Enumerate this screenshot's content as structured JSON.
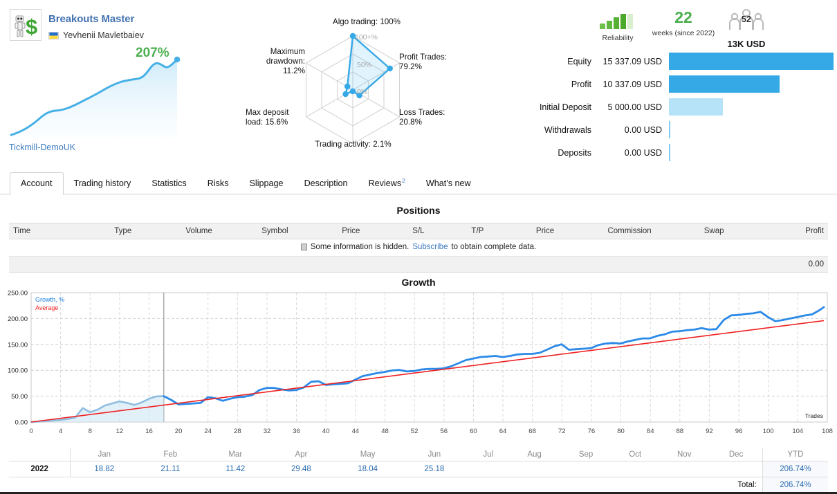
{
  "signal": {
    "title": "Breakouts Master",
    "author": "Yevhenii Mavletbaiev",
    "growth_percent": "207%",
    "broker": "Tickmill-DemoUK",
    "logo_icon": "robot-dollar-icon",
    "flag_icon": "ukraine-flag-icon"
  },
  "radar": {
    "axes": [
      {
        "name": "algo-trading",
        "label": "Algo trading: 100%",
        "value": 100
      },
      {
        "name": "profit-trades",
        "label": "Profit Trades:\n79.2%",
        "value": 79.2
      },
      {
        "name": "loss-trades",
        "label": "Loss Trades:\n20.8%",
        "value": 20.8
      },
      {
        "name": "trading-activity",
        "label": "Trading activity: 2.1%",
        "value": 2.1
      },
      {
        "name": "max-deposit-load",
        "label": "Max deposit\nload: 15.6%",
        "value": 15.6
      },
      {
        "name": "maximum-drawdown",
        "label": "Maximum\ndrawdown:\n11.2%",
        "value": 11.2
      }
    ],
    "ring_labels": [
      "100+%",
      "50%",
      "0%"
    ],
    "label_algo": "Algo trading: 100%",
    "label_profit_1": "Profit Trades:",
    "label_profit_2": "79.2%",
    "label_loss_1": "Loss Trades:",
    "label_loss_2": "20.8%",
    "label_activity": "Trading activity: 2.1%",
    "label_maxload_1": "Max deposit",
    "label_maxload_2": "load: 15.6%",
    "label_drawdown_1": "Maximum",
    "label_drawdown_2": "drawdown:",
    "label_drawdown_3": "11.2%"
  },
  "badges": {
    "reliability_caption": "Reliability",
    "reliability_filled": 4,
    "reliability_total": 5,
    "weeks_value": "22",
    "weeks_caption": "weeks (since 2022)",
    "subscribers_count": "52",
    "subscribers_caption": "13K USD"
  },
  "stats": [
    {
      "name": "Equity",
      "value": "15 337.09 USD",
      "bar_percent": 100,
      "bar_style": "solid"
    },
    {
      "name": "Profit",
      "value": "10 337.09 USD",
      "bar_percent": 67.4,
      "bar_style": "solid"
    },
    {
      "name": "Initial Deposit",
      "value": "5 000.00 USD",
      "bar_percent": 32.6,
      "bar_style": "light"
    },
    {
      "name": "Withdrawals",
      "value": "0.00 USD",
      "bar_percent": 0,
      "bar_style": "tiny"
    },
    {
      "name": "Deposits",
      "value": "0.00 USD",
      "bar_percent": 0,
      "bar_style": "tiny"
    }
  ],
  "tabs": [
    {
      "label": "Account",
      "active": true,
      "sup": ""
    },
    {
      "label": "Trading history",
      "active": false,
      "sup": ""
    },
    {
      "label": "Statistics",
      "active": false,
      "sup": ""
    },
    {
      "label": "Risks",
      "active": false,
      "sup": ""
    },
    {
      "label": "Slippage",
      "active": false,
      "sup": ""
    },
    {
      "label": "Description",
      "active": false,
      "sup": ""
    },
    {
      "label": "Reviews",
      "active": false,
      "sup": "2"
    },
    {
      "label": "What's new",
      "active": false,
      "sup": ""
    }
  ],
  "positions": {
    "title": "Positions",
    "columns": [
      "Time",
      "Type",
      "Volume",
      "Symbol",
      "Price",
      "S/L",
      "T/P",
      "Price",
      "Commission",
      "Swap",
      "Profit"
    ],
    "hidden_text_1": "Some information is hidden.",
    "hidden_link": "Subscribe",
    "hidden_text_2": "to obtain complete data.",
    "total_profit": "0.00"
  },
  "growth": {
    "title": "Growth"
  },
  "chart_data": {
    "type": "line",
    "title": "Growth",
    "xlabel": "Trades",
    "ylabel": "",
    "xlim": [
      0,
      108
    ],
    "ylim": [
      0,
      250
    ],
    "xticks": [
      0,
      4,
      8,
      12,
      16,
      20,
      24,
      28,
      32,
      36,
      40,
      44,
      48,
      52,
      56,
      60,
      64,
      68,
      72,
      76,
      80,
      84,
      88,
      92,
      96,
      100,
      104,
      108
    ],
    "yticks": [
      "0.00",
      "50.00",
      "100.00",
      "150.00",
      "200.00",
      "250.00"
    ],
    "grid": true,
    "legend": [
      "Growth, %",
      "Average"
    ],
    "legend_position": "top-left",
    "legend_colors": [
      "#1e7fe0",
      "#f02020"
    ],
    "demo_split_x": 18,
    "series": [
      {
        "name": "Growth, %",
        "color": "#2b8ae8",
        "x": [
          0,
          1,
          2,
          3,
          4,
          5,
          6,
          7,
          8,
          9,
          10,
          11,
          12,
          13,
          14,
          15,
          16,
          17,
          18,
          19,
          20,
          21,
          22,
          23,
          24,
          25,
          26,
          27,
          28,
          29,
          30,
          31,
          32,
          33,
          34,
          35,
          36,
          37,
          38,
          39,
          40,
          41,
          42,
          43,
          44,
          45,
          46,
          47,
          48,
          49,
          50,
          51,
          52,
          53,
          54,
          55,
          56,
          57,
          58,
          59,
          60,
          61,
          62,
          63,
          64,
          65,
          66,
          67,
          68,
          69,
          70,
          71,
          72,
          73,
          74,
          75,
          76,
          77,
          78,
          79,
          80,
          81,
          82,
          83,
          84,
          85,
          86,
          87,
          88,
          89,
          90,
          91,
          92,
          93,
          94,
          95,
          96
        ],
        "values": [
          0,
          1,
          2,
          3,
          4,
          6,
          9,
          27,
          19,
          24,
          32,
          36,
          40,
          43,
          37,
          33,
          38,
          45,
          50,
          43,
          34,
          35,
          36,
          37,
          48,
          46,
          41,
          45,
          48,
          49,
          52,
          62,
          66,
          66,
          63,
          61,
          62,
          67,
          63,
          60,
          62,
          73,
          74,
          67,
          68,
          69,
          70,
          77,
          93,
          100,
          104,
          107,
          111,
          112,
          109,
          111,
          114,
          115,
          115,
          117,
          124,
          130,
          134,
          126,
          127,
          128,
          127,
          134,
          128,
          131,
          135,
          142,
          144,
          150,
          152,
          152,
          157,
          160,
          165,
          162,
          164,
          180,
          189,
          190,
          192,
          193,
          196,
          186,
          178,
          180,
          183,
          186,
          189,
          191,
          199,
          205,
          207
        ]
      },
      {
        "name": "Average",
        "color": "#f02020",
        "x": [
          0,
          96
        ],
        "values": [
          0,
          196
        ]
      }
    ]
  },
  "months_table": {
    "year_header": "",
    "months": [
      "Jan",
      "Feb",
      "Mar",
      "Apr",
      "May",
      "Jun",
      "Jul",
      "Aug",
      "Sep",
      "Oct",
      "Nov",
      "Dec"
    ],
    "ytd_header": "YTD",
    "rows": [
      {
        "year": "2022",
        "values": [
          "18.82",
          "21.11",
          "11.42",
          "29.48",
          "18.04",
          "25.18",
          "",
          "",
          "",
          "",
          "",
          ""
        ],
        "ytd": "206.74%"
      }
    ],
    "total_label": "Total:",
    "total_value": "206.74%"
  },
  "colors": {
    "accent_blue": "#35a8e6",
    "link_blue": "#3a79c0",
    "green": "#4caf50",
    "growth_line": "#2b8ae8",
    "average_line": "#f02020"
  }
}
